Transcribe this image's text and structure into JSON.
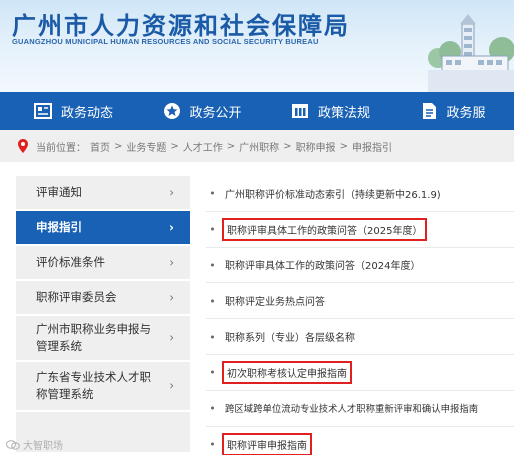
{
  "header": {
    "title": "广州市人力资源和社会保障局",
    "subtitle": "GUANGZHOU MUNICIPAL HUMAN RESOURCES AND SOCIAL SECURITY BUREAU"
  },
  "nav": {
    "items": [
      {
        "label": "政务动态",
        "icon": "news-icon"
      },
      {
        "label": "政务公开",
        "icon": "star-icon"
      },
      {
        "label": "政策法规",
        "icon": "building-icon"
      },
      {
        "label": "政务服",
        "icon": "document-icon"
      }
    ]
  },
  "breadcrumb": {
    "prefix": "当前位置：",
    "items": [
      "首页",
      ">",
      "业务专题",
      ">",
      "人才工作",
      ">",
      "广州职称",
      ">",
      "职称申报",
      ">",
      "申报指引"
    ]
  },
  "sidebar": {
    "items": [
      {
        "label": "评审通知",
        "active": false
      },
      {
        "label": "申报指引",
        "active": true
      },
      {
        "label": "评价标准条件",
        "active": false
      },
      {
        "label": "职称评审委员会",
        "active": false
      },
      {
        "label": "广州市职称业务申报与管理系统",
        "active": false
      },
      {
        "label": "广东省专业技术人才职称管理系统",
        "active": false
      },
      {
        "label": "",
        "active": false
      }
    ],
    "arrow": "›"
  },
  "list": {
    "items": [
      {
        "text": "广州职称评价标准动态索引（持续更新中26.1.9)",
        "highlighted": false
      },
      {
        "text": "职称评审具体工作的政策问答（2025年度）",
        "highlighted": true
      },
      {
        "text": "职称评审具体工作的政策问答（2024年度）",
        "highlighted": false
      },
      {
        "text": "职称评定业务热点问答",
        "highlighted": false
      },
      {
        "text": "职称系列（专业）各层级名称",
        "highlighted": false
      },
      {
        "text": "初次职称考核认定申报指南",
        "highlighted": true
      },
      {
        "text": "跨区域跨单位流动专业技术人才职称重新评审和确认申报指南",
        "highlighted": false
      },
      {
        "text": "职称评审申报指南",
        "highlighted": true
      }
    ]
  },
  "watermark": {
    "text": "大智职场"
  },
  "colors": {
    "brand_blue": "#1961b4",
    "highlight_red": "#e0201f",
    "sidebar_bg": "#efefef"
  }
}
